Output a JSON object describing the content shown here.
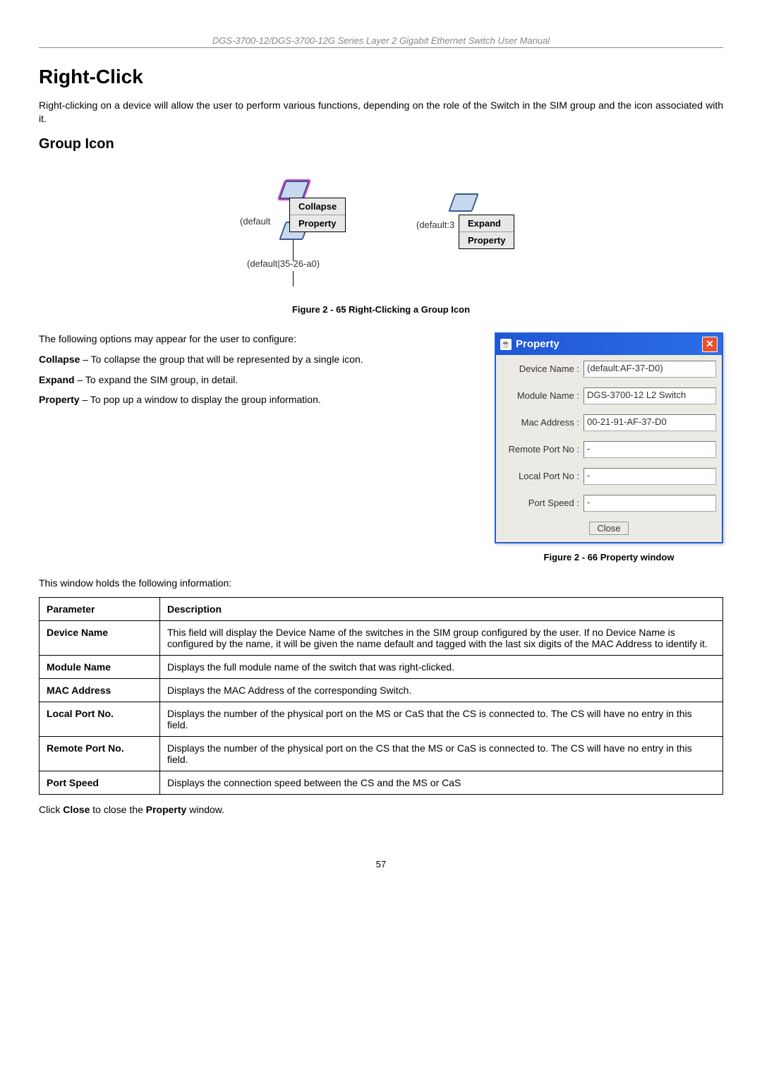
{
  "header": "DGS-3700-12/DGS-3700-12G Series Layer 2 Gigabit Ethernet Switch User Manual",
  "h1": "Right-Click",
  "intro": "Right-clicking on a device will allow the user to perform various functions, depending on the role of the Switch in the SIM group and the icon associated with it.",
  "h2": "Group Icon",
  "fig1": {
    "left_label": "(default",
    "left_label2": "(default|35-26-a0)",
    "menu1": [
      "Collapse",
      "Property"
    ],
    "right_label": "(default:3",
    "menu2": [
      "Expand",
      "Property"
    ],
    "caption": "Figure 2 - 65 Right-Clicking a Group Icon"
  },
  "options_intro": "The following options may appear for the user to configure:",
  "opts": [
    {
      "term": "Collapse",
      "rest": " – To collapse the group that will be represented by a single icon."
    },
    {
      "term": "Expand",
      "rest": " – To expand the SIM group, in detail."
    },
    {
      "term": "Property",
      "rest": " – To pop up a window to display the group information."
    }
  ],
  "prop": {
    "title": "Property",
    "rows": [
      {
        "label": "Device Name :",
        "value": "(default:AF-37-D0)"
      },
      {
        "label": "Module Name :",
        "value": "DGS-3700-12 L2 Switch"
      },
      {
        "label": "Mac Address :",
        "value": "00-21-91-AF-37-D0"
      },
      {
        "label": "Remote Port No :",
        "value": "-"
      },
      {
        "label": "Local Port No :",
        "value": "-"
      },
      {
        "label": "Port Speed :",
        "value": "-"
      }
    ],
    "close": "Close",
    "caption": "Figure 2 - 66 Property window"
  },
  "table_intro": "This window holds the following information:",
  "table": {
    "headers": [
      "Parameter",
      "Description"
    ],
    "rows": [
      {
        "p": "Device Name",
        "d": "This field will display the Device Name of the switches in the SIM group configured by the user. If no Device Name is configured by the name, it will be given the name default and tagged with the last six digits of the MAC Address to identify it."
      },
      {
        "p": "Module Name",
        "d": "Displays the full module name of the switch that was right-clicked."
      },
      {
        "p": "MAC Address",
        "d": "Displays the MAC Address of the corresponding Switch."
      },
      {
        "p": "Local Port No.",
        "d": "Displays the number of the physical port on the MS or CaS that the CS is connected to. The CS will have no entry in this field."
      },
      {
        "p": "Remote Port No.",
        "d": "Displays the number of the physical port on the CS that the MS or CaS is connected to. The CS will have no entry in this field."
      },
      {
        "p": "Port Speed",
        "d": "Displays the connection speed between the CS and the MS or CaS"
      }
    ]
  },
  "closing": {
    "pre": "Click ",
    "b1": "Close",
    "mid": " to close the ",
    "b2": "Property",
    "post": " window."
  },
  "page": "57"
}
